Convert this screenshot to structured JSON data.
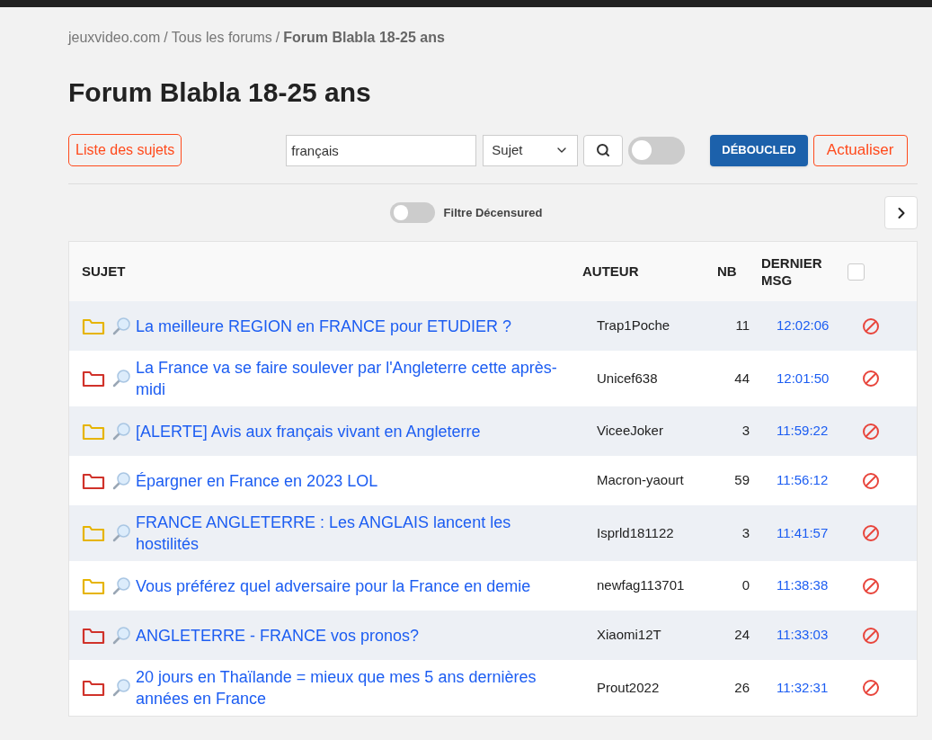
{
  "breadcrumb": [
    {
      "kind": "link",
      "label": "jeuxvideo.com",
      "current": false
    },
    {
      "kind": "separator",
      "label": "/"
    },
    {
      "kind": "link",
      "label": "Tous les forums",
      "current": false
    },
    {
      "kind": "separator",
      "label": "/"
    },
    {
      "kind": "link",
      "label": "Forum Blabla 18-25 ans",
      "current": true
    }
  ],
  "title": "Forum Blabla 18-25 ans",
  "toolbar": {
    "list_button": "Liste des sujets",
    "search": {
      "value": "français"
    },
    "search_type": "Sujet",
    "search_toggle": {
      "on": false
    },
    "deboucled_button": "DÉBOUCLED",
    "refresh_button": "Actualiser"
  },
  "filter": {
    "label": "Filtre Décensured",
    "on": false
  },
  "table": {
    "columns": [
      "SUJET",
      "AUTEUR",
      "NB",
      "DERNIER MSG"
    ],
    "select_all": {
      "checked": false
    },
    "rows": [
      {
        "subject": "La meilleure REGION en FRANCE pour ETUDIER ?",
        "hot": false,
        "author": "Trap1Poche",
        "count": "11",
        "last": "12:02:06"
      },
      {
        "subject": "La France va se faire soulever par l'Angleterre cette après-midi",
        "hot": true,
        "author": "Unicef638",
        "count": "44",
        "last": "12:01:50"
      },
      {
        "subject": "[ALERTE] Avis aux français vivant en Angleterre",
        "hot": false,
        "author": "ViceeJoker",
        "count": "3",
        "last": "11:59:22"
      },
      {
        "subject": "Épargner en France en 2023 LOL",
        "hot": true,
        "author": "Macron-yaourt",
        "count": "59",
        "last": "11:56:12"
      },
      {
        "subject": "FRANCE ANGLETERRE : Les ANGLAIS lancent les hostilités",
        "hot": false,
        "author": "Isprld181122",
        "count": "3",
        "last": "11:41:57"
      },
      {
        "subject": "Vous préférez quel adversaire pour la France en demie",
        "hot": false,
        "author": "newfag113701",
        "count": "0",
        "last": "11:38:38"
      },
      {
        "subject": "ANGLETERRE - FRANCE vos pronos?",
        "hot": true,
        "author": "Xiaomi12T",
        "count": "24",
        "last": "11:33:03"
      },
      {
        "subject": "20 jours en Thaïlande = mieux que mes 5 ans dernières années en France",
        "hot": true,
        "author": "Prout2022",
        "count": "26",
        "last": "11:32:31"
      }
    ]
  }
}
